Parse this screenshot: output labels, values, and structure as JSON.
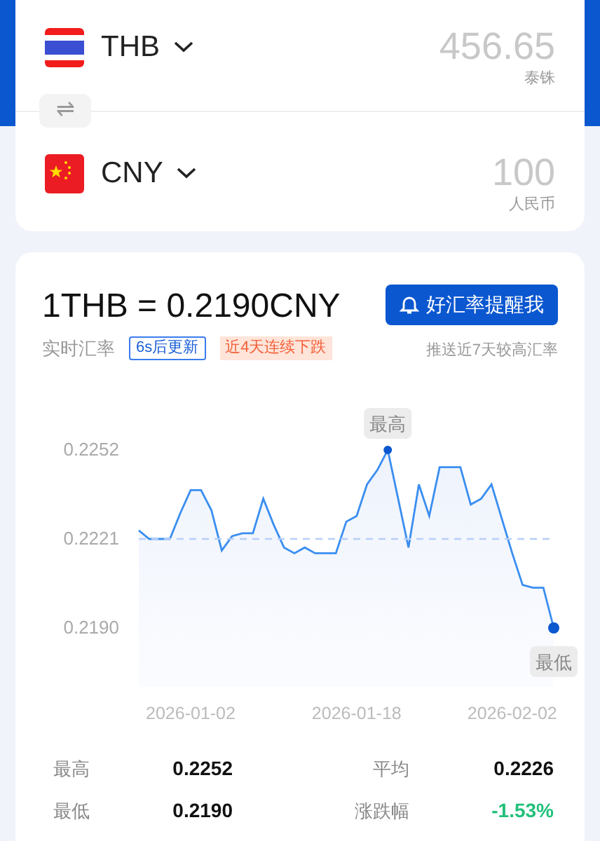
{
  "converter": [
    {
      "currency": "THB",
      "kind": "thailand",
      "amount": "456.65",
      "unit": "泰铢"
    },
    {
      "currency": "CNY",
      "kind": "china",
      "amount": "100",
      "unit": "人民币"
    }
  ],
  "swap": {
    "icon": "⇌"
  },
  "rate": {
    "title": "1THB = 0.2190CNY",
    "label": "实时汇率",
    "update_badge": "6s后更新",
    "trend_badge": "近4天连续下跌",
    "alert_button": "好汇率提醒我",
    "alert_hint": "推送近7天较高汇率",
    "chart_data": {
      "type": "area",
      "ylim": [
        0.219,
        0.2252
      ],
      "categories": [
        null,
        null,
        null,
        null,
        null,
        "2026-01-02",
        null,
        null,
        null,
        null,
        null,
        null,
        null,
        null,
        null,
        null,
        null,
        null,
        null,
        null,
        null,
        "2026-01-18",
        null,
        null,
        null,
        null,
        null,
        null,
        null,
        null,
        null,
        null,
        null,
        null,
        null,
        null,
        "2026-02-02",
        null,
        null,
        null,
        null
      ],
      "yticks": [
        {
          "value": 0.2252,
          "label": "0.2252"
        },
        {
          "value": 0.2221,
          "label": "0.2221"
        },
        {
          "value": 0.219,
          "label": "0.2190"
        }
      ],
      "series": [
        {
          "color": "#3a8ef0",
          "values": [
            0.2224,
            0.2221,
            0.2221,
            0.2221,
            0.223,
            0.2238,
            0.2238,
            0.2231,
            0.2217,
            0.2222,
            0.2223,
            0.2223,
            0.2235,
            0.2226,
            0.2218,
            0.2216,
            0.2218,
            0.2216,
            0.2216,
            0.2216,
            0.2227,
            0.2229,
            0.224,
            0.2245,
            0.2252,
            0.2235,
            0.2218,
            0.224,
            0.2229,
            0.2246,
            0.2246,
            0.2246,
            0.2233,
            0.2235,
            0.224,
            0.2228,
            0.2216,
            0.2205,
            0.2204,
            0.2204,
            0.219
          ]
        }
      ],
      "ref_lines": [
        {
          "axis": "y",
          "value": 0.2221
        }
      ],
      "annotations": [
        "最高",
        "最低"
      ]
    },
    "stats": [
      {
        "label": "最高",
        "value": "0.2252",
        "color": "#111111"
      },
      {
        "label": "平均",
        "value": "0.2226",
        "color": "#111111"
      },
      {
        "label": "最低",
        "value": "0.2190",
        "color": "#111111"
      },
      {
        "label": "涨跌幅",
        "value": "-1.53%",
        "color": "#22c07a"
      }
    ]
  }
}
